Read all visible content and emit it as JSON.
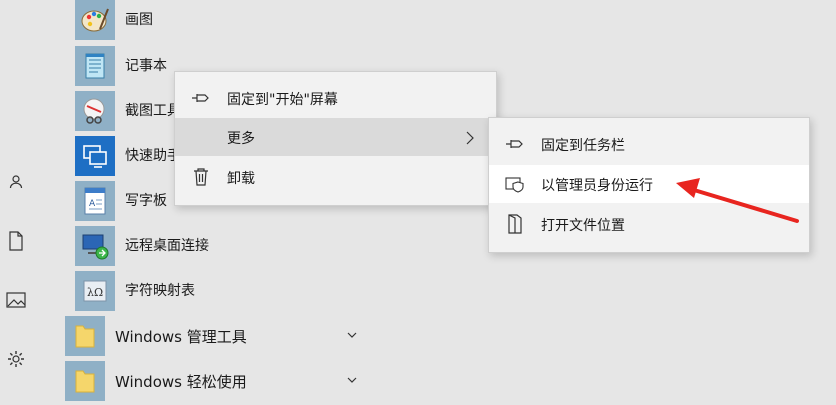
{
  "apps": [
    {
      "label": "画图",
      "icon": "paint-icon"
    },
    {
      "label": "记事本",
      "icon": "notepad-icon"
    },
    {
      "label": "截图工具",
      "icon": "snipping-tool-icon"
    },
    {
      "label": "快速助手",
      "icon": "quick-assist-icon"
    },
    {
      "label": "写字板",
      "icon": "wordpad-icon"
    },
    {
      "label": "远程桌面连接",
      "icon": "remote-desktop-icon"
    },
    {
      "label": "字符映射表",
      "icon": "character-map-icon"
    }
  ],
  "folders": [
    {
      "label": "Windows 管理工具"
    },
    {
      "label": "Windows 轻松使用"
    }
  ],
  "context_menu": {
    "pin_start": "固定到\"开始\"屏幕",
    "more": "更多",
    "uninstall": "卸载"
  },
  "submenu": {
    "pin_taskbar": "固定到任务栏",
    "run_as_admin": "以管理员身份运行",
    "open_location": "打开文件位置"
  },
  "colors": {
    "accent_arrow": "#e8251f",
    "tile": "#8fb0c6"
  }
}
